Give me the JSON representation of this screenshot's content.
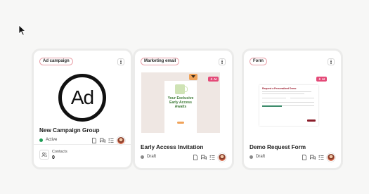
{
  "cards": [
    {
      "tag": "Ad campaign",
      "title": "New Campaign Group",
      "status": "Active",
      "status_color": "#1f9d55",
      "logo_text": "Ad",
      "contacts": {
        "label": "Contacts",
        "value": "0"
      }
    },
    {
      "tag": "Marketing email",
      "title": "Early Access Invitation",
      "status": "Draft",
      "status_color": "#8a8a8a",
      "ai_badge": "✦ AI",
      "preview_heading": "Your Exclusive Early Access Awaits"
    },
    {
      "tag": "Form",
      "title": "Demo Request Form",
      "status": "Draft",
      "status_color": "#8a8a8a",
      "ai_badge": "✦ AI",
      "preview_heading": "Request a Personalized Demo"
    }
  ],
  "icons": [
    "cursor-icon",
    "kebab-menu-icon",
    "document-icon",
    "comments-icon",
    "checklist-icon",
    "contacts-icon"
  ],
  "colors": {
    "tag_border": "#e9a1a9",
    "ai_badge": "#e44a78",
    "email_heading": "#3d7a35",
    "form_button": "#8a1d2a"
  }
}
